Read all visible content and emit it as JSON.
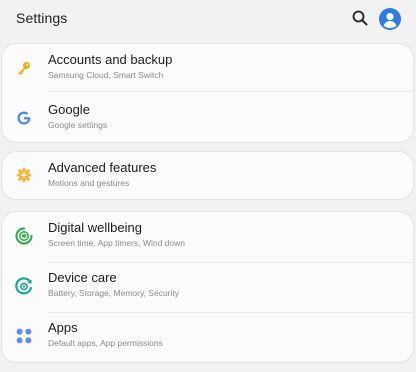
{
  "header": {
    "title": "Settings",
    "search_icon": "search-icon",
    "account_icon": "account-circle-icon"
  },
  "groups": [
    {
      "items": [
        {
          "label": "Accounts and backup",
          "sub": "Samsung Cloud, Smart Switch",
          "icon": "key-icon",
          "icon_color": "#e0b21c"
        },
        {
          "label": "Google",
          "sub": "Google settings",
          "icon": "google-g-icon",
          "icon_color": "#4a86e8"
        }
      ]
    },
    {
      "items": [
        {
          "label": "Advanced features",
          "sub": "Motions and gestures",
          "icon": "gear-plus-icon",
          "icon_color": "#f0b63a"
        }
      ]
    },
    {
      "items": [
        {
          "label": "Digital wellbeing",
          "sub": "Screen time, App timers, Wind down",
          "icon": "wellbeing-icon",
          "icon_color": "#3caa56"
        },
        {
          "label": "Device care",
          "sub": "Battery, Storage, Memory, Security",
          "icon": "device-care-icon",
          "icon_color": "#1aa59a"
        },
        {
          "label": "Apps",
          "sub": "Default apps, App permissions",
          "icon": "apps-grid-icon",
          "icon_color": "#5b8def"
        }
      ]
    }
  ],
  "colors": {
    "background": "#f2f2f2",
    "card": "#fbfbfb",
    "accent": "#2d7be5"
  }
}
